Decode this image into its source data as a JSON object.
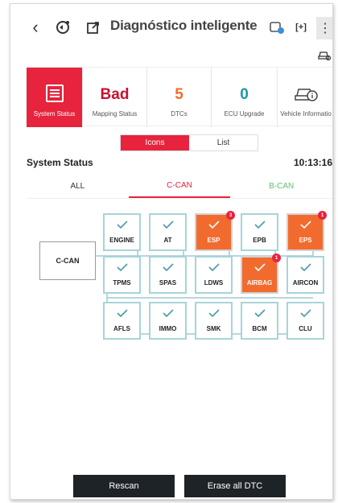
{
  "app": {
    "title": "Diagnóstico inteligente"
  },
  "topbar": {
    "icons": [
      "back-icon",
      "vci-connect-icon",
      "export-icon",
      "vehicle-switch-icon",
      "fullscreen-icon",
      "more-vert-icon",
      "car-search-icon"
    ],
    "back_glyph": "‹",
    "fullscreen_glyph": "[+]",
    "more_glyph": "⋮",
    "car_glyph": "⛐"
  },
  "summary": {
    "system_status_label": "System Status",
    "mapping_value": "Bad",
    "mapping_label": "Mapping Status",
    "dtcs_value": "5",
    "dtcs_label": "DTCs",
    "ecu_upgrade_value": "0",
    "ecu_upgrade_label": "ECU Upgrade",
    "vehicle_info_label": "Vehicle Informatio",
    "colors": {
      "accent": "#e8233d",
      "bad": "#c8102e",
      "dtcs": "#f26b2e",
      "upgrade": "#1a9aa8"
    }
  },
  "view_toggle": {
    "icons_label": "Icons",
    "list_label": "List",
    "selected": "Icons"
  },
  "section": {
    "title": "System Status",
    "time": "10:13:16"
  },
  "bus_tabs": {
    "all": "ALL",
    "ccan": "C-CAN",
    "bcan": "B-CAN",
    "selected": "C-CAN"
  },
  "diagram": {
    "root_label": "C-CAN",
    "ecus": [
      {
        "name": "ENGINE",
        "fault": false,
        "count": ""
      },
      {
        "name": "AT",
        "fault": false,
        "count": ""
      },
      {
        "name": "ESP",
        "fault": true,
        "count": "3"
      },
      {
        "name": "EPB",
        "fault": false,
        "count": ""
      },
      {
        "name": "EPS",
        "fault": true,
        "count": "1"
      },
      {
        "name": "TPMS",
        "fault": false,
        "count": ""
      },
      {
        "name": "SPAS",
        "fault": false,
        "count": ""
      },
      {
        "name": "LDWS",
        "fault": false,
        "count": ""
      },
      {
        "name": "AIRBAG",
        "fault": true,
        "count": "1"
      },
      {
        "name": "AIRCON",
        "fault": false,
        "count": ""
      },
      {
        "name": "AFLS",
        "fault": false,
        "count": ""
      },
      {
        "name": "IMMO",
        "fault": false,
        "count": ""
      },
      {
        "name": "SMK",
        "fault": false,
        "count": ""
      },
      {
        "name": "BCM",
        "fault": false,
        "count": ""
      },
      {
        "name": "CLU",
        "fault": false,
        "count": ""
      }
    ],
    "colors": {
      "ok_border": "#a6d4d9",
      "fault_fill": "#f26b2e",
      "badge": "#e8233d",
      "line": "#9fc9d0"
    }
  },
  "footer": {
    "rescan_label": "Rescan",
    "erase_label": "Erase all DTC"
  }
}
